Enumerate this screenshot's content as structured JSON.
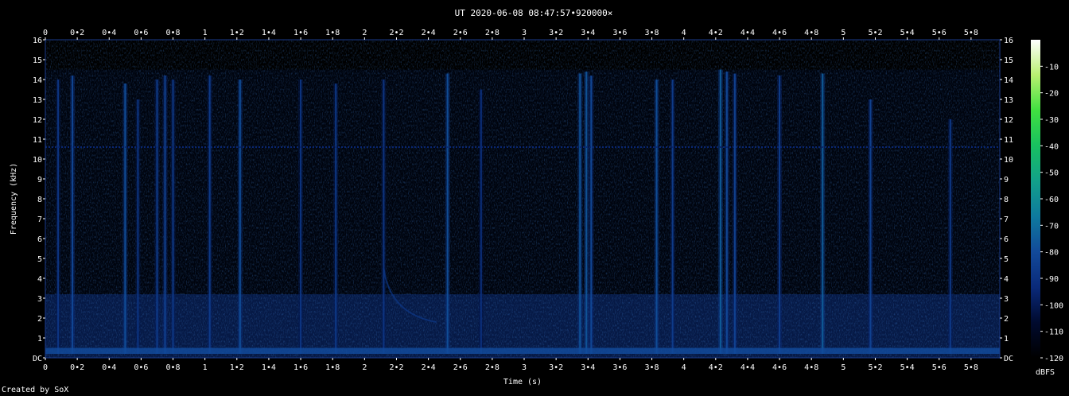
{
  "chart_data": {
    "type": "heatmap",
    "title": "UT 2020-06-08 08:47:57•920000×",
    "xlabel": "Time (s)",
    "ylabel": "Frequency (kHz)",
    "xlim": [
      0,
      5.98
    ],
    "ylim": [
      0,
      16
    ],
    "x_ticks": [
      "0",
      "0•2",
      "0•4",
      "0•6",
      "0•8",
      "1",
      "1•2",
      "1•4",
      "1•6",
      "1•8",
      "2",
      "2•2",
      "2•4",
      "2•6",
      "2•8",
      "3",
      "3•2",
      "3•4",
      "3•6",
      "3•8",
      "4",
      "4•2",
      "4•4",
      "4•6",
      "4•8",
      "5",
      "5•2",
      "5•4",
      "5•6",
      "5•8"
    ],
    "x_tick_values": [
      0,
      0.2,
      0.4,
      0.6,
      0.8,
      1.0,
      1.2,
      1.4,
      1.6,
      1.8,
      2.0,
      2.2,
      2.4,
      2.6,
      2.8,
      3.0,
      3.2,
      3.4,
      3.6,
      3.8,
      4.0,
      4.2,
      4.4,
      4.6,
      4.8,
      5.0,
      5.2,
      5.4,
      5.6,
      5.8
    ],
    "y_ticks": [
      "DC",
      "1",
      "2",
      "3",
      "4",
      "5",
      "6",
      "7",
      "8",
      "9",
      "10",
      "11",
      "12",
      "13",
      "14",
      "15",
      "16"
    ],
    "y_tick_values": [
      0,
      1,
      2,
      3,
      4,
      5,
      6,
      7,
      8,
      9,
      10,
      11,
      12,
      13,
      14,
      15,
      16
    ],
    "colorbar": {
      "label": "dBFS",
      "ticks": [
        "-10",
        "-20",
        "-30",
        "-40",
        "-50",
        "-60",
        "-70",
        "-80",
        "-90",
        "-100",
        "-110",
        "-120"
      ],
      "tick_values": [
        -10,
        -20,
        -30,
        -40,
        -50,
        -60,
        -70,
        -80,
        -90,
        -100,
        -110,
        -120
      ],
      "range": [
        -120,
        0
      ],
      "colors": [
        "#000000",
        "#000a2e",
        "#0a2a7a",
        "#124a9a",
        "#0e7a9e",
        "#12a08a",
        "#18c060",
        "#40e040",
        "#b8f070",
        "#ffffff"
      ]
    },
    "background_level_dbfs": -105,
    "low_band_level_dbfs": -92,
    "tone": {
      "frequency_khz": 10.6,
      "level_dbfs": -95
    },
    "dc_band": {
      "frequency_khz": 0.3,
      "level_dbfs": -80
    },
    "events": [
      {
        "time_s": 0.08,
        "top_khz": 14.0,
        "level_dbfs": -88
      },
      {
        "time_s": 0.17,
        "top_khz": 14.2,
        "level_dbfs": -80
      },
      {
        "time_s": 0.5,
        "top_khz": 13.8,
        "level_dbfs": -78
      },
      {
        "time_s": 0.58,
        "top_khz": 13.0,
        "level_dbfs": -88
      },
      {
        "time_s": 0.7,
        "top_khz": 14.0,
        "level_dbfs": -85
      },
      {
        "time_s": 0.75,
        "top_khz": 14.2,
        "level_dbfs": -82
      },
      {
        "time_s": 0.8,
        "top_khz": 14.0,
        "level_dbfs": -86
      },
      {
        "time_s": 1.03,
        "top_khz": 14.2,
        "level_dbfs": -85
      },
      {
        "time_s": 1.22,
        "top_khz": 14.0,
        "level_dbfs": -78
      },
      {
        "time_s": 1.6,
        "top_khz": 14.0,
        "level_dbfs": -88
      },
      {
        "time_s": 1.82,
        "top_khz": 13.8,
        "level_dbfs": -86
      },
      {
        "time_s": 2.12,
        "top_khz": 14.0,
        "level_dbfs": -88
      },
      {
        "time_s": 2.52,
        "top_khz": 14.3,
        "level_dbfs": -78
      },
      {
        "time_s": 2.73,
        "top_khz": 13.5,
        "level_dbfs": -90
      },
      {
        "time_s": 3.35,
        "top_khz": 14.3,
        "level_dbfs": -76
      },
      {
        "time_s": 3.39,
        "top_khz": 14.4,
        "level_dbfs": -76
      },
      {
        "time_s": 3.42,
        "top_khz": 14.2,
        "level_dbfs": -80
      },
      {
        "time_s": 3.83,
        "top_khz": 14.0,
        "level_dbfs": -78
      },
      {
        "time_s": 3.93,
        "top_khz": 14.0,
        "level_dbfs": -85
      },
      {
        "time_s": 4.23,
        "top_khz": 14.5,
        "level_dbfs": -74
      },
      {
        "time_s": 4.27,
        "top_khz": 14.4,
        "level_dbfs": -80
      },
      {
        "time_s": 4.32,
        "top_khz": 14.3,
        "level_dbfs": -82
      },
      {
        "time_s": 4.6,
        "top_khz": 14.2,
        "level_dbfs": -84
      },
      {
        "time_s": 4.87,
        "top_khz": 14.3,
        "level_dbfs": -74
      },
      {
        "time_s": 5.17,
        "top_khz": 13.0,
        "level_dbfs": -82
      },
      {
        "time_s": 5.67,
        "top_khz": 12.0,
        "level_dbfs": -86
      }
    ],
    "chirp": {
      "start_time_s": 2.12,
      "end_time_s": 2.45,
      "start_khz": 4.5,
      "end_khz": 1.8,
      "level_dbfs": -88
    }
  },
  "footer": {
    "credit": "Created by SoX"
  }
}
